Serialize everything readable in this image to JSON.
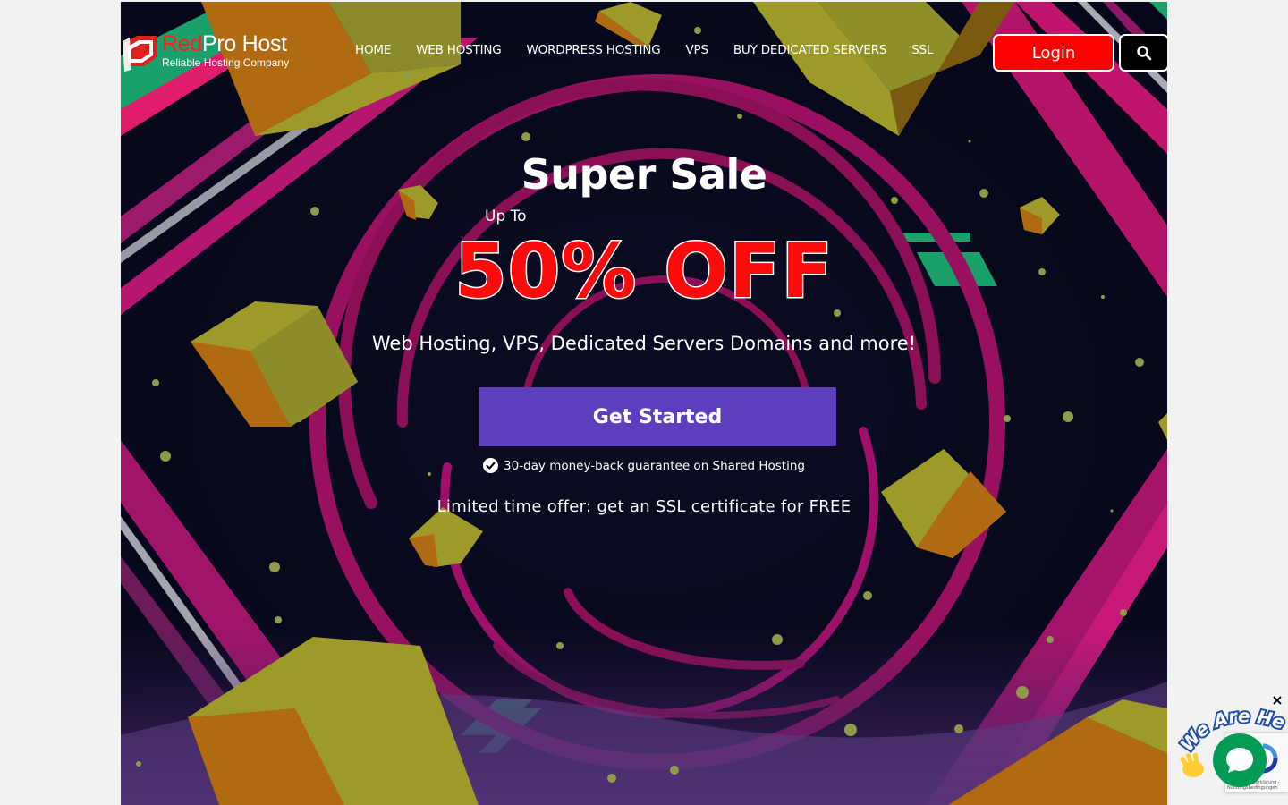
{
  "brand": {
    "name_red": "Red",
    "name_white": "Pro Host",
    "tagline": "Reliable Hosting Company"
  },
  "nav": {
    "items": [
      {
        "label": "HOME"
      },
      {
        "label": "WEB HOSTING"
      },
      {
        "label": "WORDPRESS HOSTING"
      },
      {
        "label": "VPS"
      },
      {
        "label": "BUY DEDICATED SERVERS"
      },
      {
        "label": "SSL"
      }
    ],
    "login_label": "Login",
    "search_icon": "search-icon"
  },
  "hero": {
    "title": "Super Sale",
    "up_to": "Up To",
    "discount": "50% OFF",
    "subtitle": "Web Hosting, VPS, Dedicated Servers Domains and more!",
    "cta_label": "Get Started",
    "guarantee": "30-day money-back guarantee on Shared Hosting",
    "offer": "Limited time offer: get an SSL certificate for FREE"
  },
  "widgets": {
    "we_are_here": "We Are Here!",
    "close": "×",
    "recaptcha_text_1": "Datenschutzerklärung -",
    "recaptcha_text_2": "Nutzungsbedingungen"
  },
  "colors": {
    "accent_red": "#ff0000",
    "cta_purple": "#5d3fbd",
    "background_dark": "#0a0a1e",
    "chat_green": "#009b55"
  }
}
